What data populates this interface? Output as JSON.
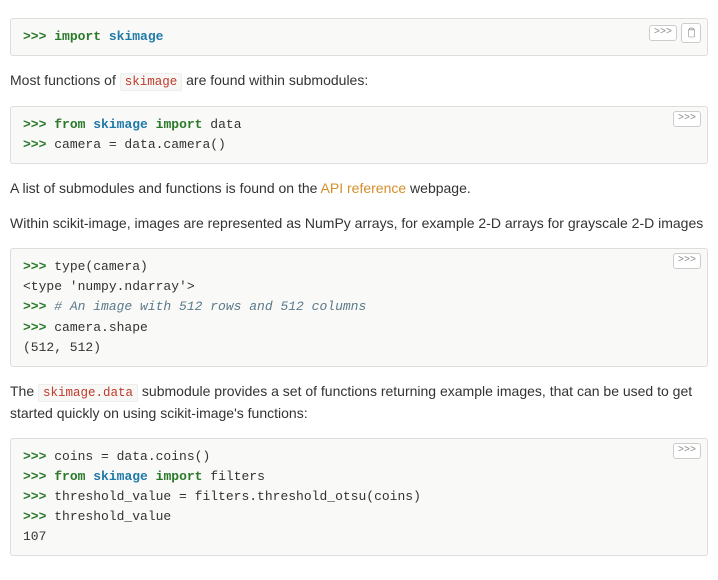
{
  "blocks": {
    "b1": {
      "tokens": [
        [
          {
            "cls": "prompt",
            "t": ">>> "
          },
          {
            "cls": "kw",
            "t": "import"
          },
          {
            "cls": "plain",
            "t": " "
          },
          {
            "cls": "nm",
            "t": "skimage"
          }
        ]
      ],
      "showRun": true,
      "showCopy": true
    },
    "b2": {
      "tokens": [
        [
          {
            "cls": "prompt",
            "t": ">>> "
          },
          {
            "cls": "kw",
            "t": "from"
          },
          {
            "cls": "plain",
            "t": " "
          },
          {
            "cls": "nm",
            "t": "skimage"
          },
          {
            "cls": "plain",
            "t": " "
          },
          {
            "cls": "kw",
            "t": "import"
          },
          {
            "cls": "plain",
            "t": " data"
          }
        ],
        [
          {
            "cls": "prompt",
            "t": ">>> "
          },
          {
            "cls": "plain",
            "t": "camera = data.camera()"
          }
        ]
      ],
      "showRun": true,
      "showCopy": false
    },
    "b3": {
      "tokens": [
        [
          {
            "cls": "prompt",
            "t": ">>> "
          },
          {
            "cls": "plain",
            "t": "type(camera)"
          }
        ],
        [
          {
            "cls": "plain",
            "t": "<type 'numpy.ndarray'>"
          }
        ],
        [
          {
            "cls": "prompt",
            "t": ">>> "
          },
          {
            "cls": "comment",
            "t": "# An image with 512 rows and 512 columns"
          }
        ],
        [
          {
            "cls": "prompt",
            "t": ">>> "
          },
          {
            "cls": "plain",
            "t": "camera.shape"
          }
        ],
        [
          {
            "cls": "plain",
            "t": "(512, 512)"
          }
        ]
      ],
      "showRun": true,
      "showCopy": false
    },
    "b4": {
      "tokens": [
        [
          {
            "cls": "prompt",
            "t": ">>> "
          },
          {
            "cls": "plain",
            "t": "coins = data.coins()"
          }
        ],
        [
          {
            "cls": "prompt",
            "t": ">>> "
          },
          {
            "cls": "kw",
            "t": "from"
          },
          {
            "cls": "plain",
            "t": " "
          },
          {
            "cls": "nm",
            "t": "skimage"
          },
          {
            "cls": "plain",
            "t": " "
          },
          {
            "cls": "kw",
            "t": "import"
          },
          {
            "cls": "plain",
            "t": " filters"
          }
        ],
        [
          {
            "cls": "prompt",
            "t": ">>> "
          },
          {
            "cls": "plain",
            "t": "threshold_value = filters.threshold_otsu(coins)"
          }
        ],
        [
          {
            "cls": "prompt",
            "t": ">>> "
          },
          {
            "cls": "plain",
            "t": "threshold_value"
          }
        ],
        [
          {
            "cls": "plain",
            "t": "107"
          }
        ]
      ],
      "showRun": true,
      "showCopy": false
    }
  },
  "paragraphs": {
    "p1_pre": "Most functions of ",
    "p1_code": "skimage",
    "p1_post": " are found within submodules:",
    "p2_pre": "A list of submodules and functions is found on the ",
    "p2_link": "API reference",
    "p2_post": " webpage.",
    "p3": "Within scikit-image, images are represented as NumPy arrays, for example 2-D arrays for grayscale 2-D images",
    "p4_pre": "The ",
    "p4_code": "skimage.data",
    "p4_post": " submodule provides a set of functions returning example images, that can be used to get started quickly on using scikit-image's functions:"
  },
  "buttons": {
    "run": ">>>"
  }
}
